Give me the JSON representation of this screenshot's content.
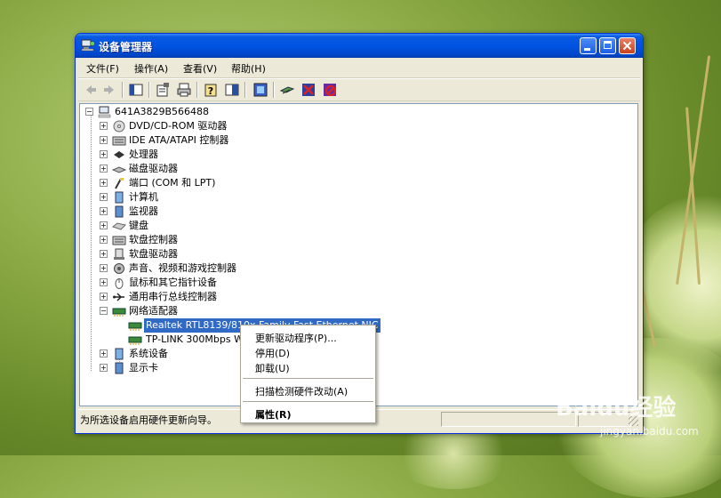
{
  "window": {
    "title": "设备管理器"
  },
  "menu": [
    "文件(F)",
    "操作(A)",
    "查看(V)",
    "帮助(H)"
  ],
  "toolbar": [
    "back-icon",
    "forward-icon",
    "show-hide-console-tree-icon",
    "properties-icon",
    "print-icon",
    "help-icon",
    "toggle-pane-icon",
    "update-driver-icon",
    "scan-hardware-icon",
    "uninstall-icon",
    "disable-icon"
  ],
  "tree": {
    "root": "641A3829B566488",
    "categories": [
      "DVD/CD-ROM 驱动器",
      "IDE ATA/ATAPI 控制器",
      "处理器",
      "磁盘驱动器",
      "端口 (COM 和 LPT)",
      "计算机",
      "监视器",
      "键盘",
      "软盘控制器",
      "软盘驱动器",
      "声音、视频和游戏控制器",
      "鼠标和其它指针设备",
      "通用串行总线控制器",
      "网络适配器",
      "系统设备",
      "显示卡"
    ],
    "network_children": [
      "Realtek RTL8139/810x Family Fast Ethernet NIC",
      "TP-LINK 300Mbps Wireless N Adapter"
    ]
  },
  "context_menu": {
    "items": [
      "更新驱动程序(P)...",
      "停用(D)",
      "卸载(U)",
      "扫描检测硬件改动(A)",
      "属性(R)"
    ]
  },
  "status": {
    "text": "为所选设备启用硬件更新向导。"
  },
  "watermark": {
    "brand": "Baidu经验",
    "url": "jingyan.baidu.com"
  },
  "colors": {
    "title_bar": "#0054e3",
    "selection": "#316ac5",
    "window_bg": "#ece9d8"
  }
}
